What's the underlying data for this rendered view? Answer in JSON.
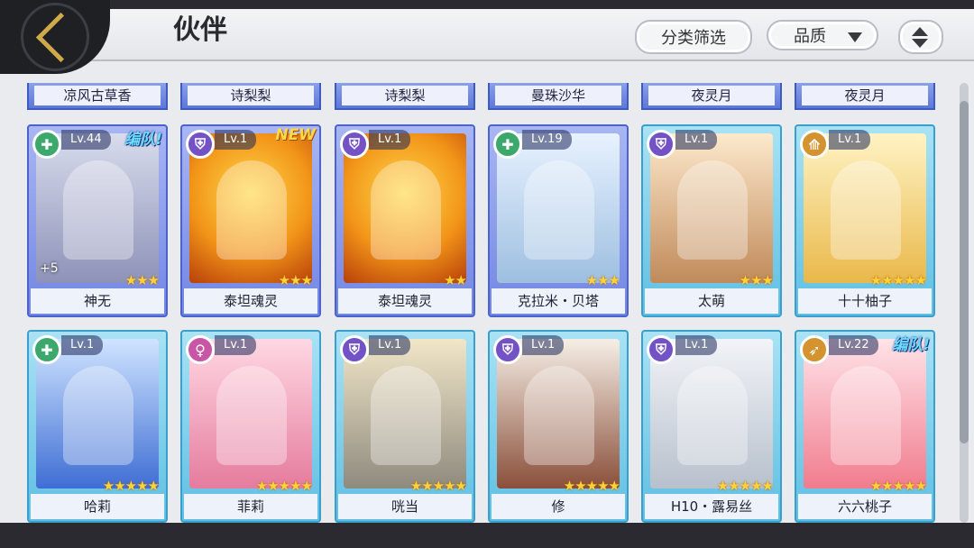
{
  "header": {
    "title": "伙伴",
    "filter_label": "分类筛选",
    "quality_label": "品质"
  },
  "name_strips": [
    "凉风古草香",
    "诗梨梨",
    "诗梨梨",
    "曼珠沙华",
    "夜灵月",
    "夜灵月"
  ],
  "cards": [
    {
      "name": "神无",
      "level": "Lv.44",
      "tag": "编队!",
      "stars": "★★★",
      "extra": "+5",
      "class_icon": "plus-icon"
    },
    {
      "name": "泰坦魂灵",
      "level": "Lv.1",
      "tag": "NEW",
      "stars": "★★★",
      "extra": "",
      "class_icon": "shield-icon"
    },
    {
      "name": "泰坦魂灵",
      "level": "Lv.1",
      "tag": "",
      "stars": "★★",
      "extra": "",
      "class_icon": "shield-icon"
    },
    {
      "name": "克拉米・贝塔",
      "level": "Lv.19",
      "tag": "",
      "stars": "★★★",
      "extra": "",
      "class_icon": "plus-icon"
    },
    {
      "name": "太萌",
      "level": "Lv.1",
      "tag": "",
      "stars": "★★★",
      "extra": "",
      "class_icon": "shield-icon"
    },
    {
      "name": "十十柚子",
      "level": "Lv.1",
      "tag": "",
      "stars": "★★★★★",
      "extra": "",
      "class_icon": "spear-icon"
    },
    {
      "name": "哈莉",
      "level": "Lv.1",
      "tag": "",
      "stars": "★★★★★",
      "extra": "",
      "class_icon": "plus-icon"
    },
    {
      "name": "菲莉",
      "level": "Lv.1",
      "tag": "",
      "stars": "★★★★★",
      "extra": "",
      "class_icon": "female-icon"
    },
    {
      "name": "咣当",
      "level": "Lv.1",
      "tag": "",
      "stars": "★★★★★",
      "extra": "",
      "class_icon": "shield-icon"
    },
    {
      "name": "修",
      "level": "Lv.1",
      "tag": "",
      "stars": "★★★★★",
      "extra": "",
      "class_icon": "shield-icon"
    },
    {
      "name": "H10・露易丝",
      "level": "Lv.1",
      "tag": "",
      "stars": "★★★★★",
      "extra": "",
      "class_icon": "shield-icon"
    },
    {
      "name": "六六桃子",
      "level": "Lv.22",
      "tag": "编队!",
      "stars": "★★★★★",
      "extra": "",
      "class_icon": "bow-icon"
    }
  ]
}
